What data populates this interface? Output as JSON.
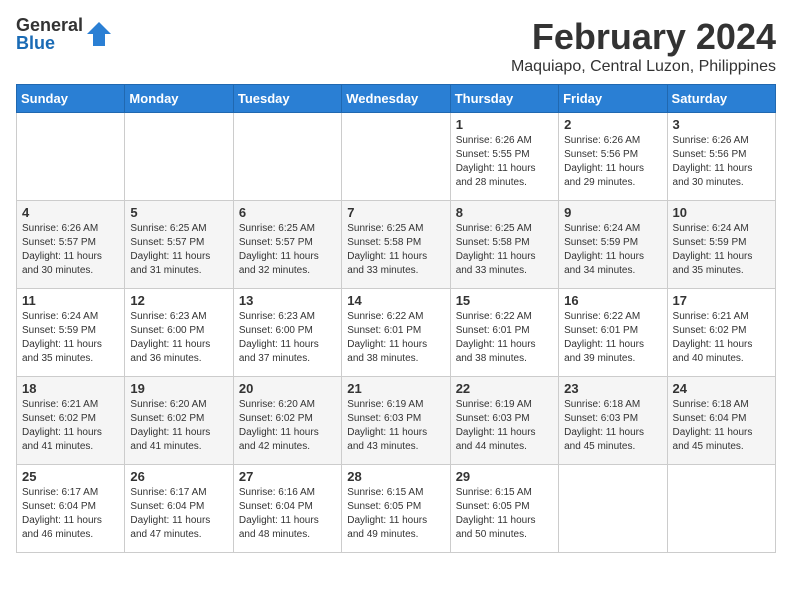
{
  "header": {
    "logo_general": "General",
    "logo_blue": "Blue",
    "month_title": "February 2024",
    "location": "Maquiapo, Central Luzon, Philippines"
  },
  "days_of_week": [
    "Sunday",
    "Monday",
    "Tuesday",
    "Wednesday",
    "Thursday",
    "Friday",
    "Saturday"
  ],
  "weeks": [
    {
      "days": [
        {
          "num": "",
          "info": ""
        },
        {
          "num": "",
          "info": ""
        },
        {
          "num": "",
          "info": ""
        },
        {
          "num": "",
          "info": ""
        },
        {
          "num": "1",
          "info": "Sunrise: 6:26 AM\nSunset: 5:55 PM\nDaylight: 11 hours and 28 minutes."
        },
        {
          "num": "2",
          "info": "Sunrise: 6:26 AM\nSunset: 5:56 PM\nDaylight: 11 hours and 29 minutes."
        },
        {
          "num": "3",
          "info": "Sunrise: 6:26 AM\nSunset: 5:56 PM\nDaylight: 11 hours and 30 minutes."
        }
      ]
    },
    {
      "days": [
        {
          "num": "4",
          "info": "Sunrise: 6:26 AM\nSunset: 5:57 PM\nDaylight: 11 hours and 30 minutes."
        },
        {
          "num": "5",
          "info": "Sunrise: 6:25 AM\nSunset: 5:57 PM\nDaylight: 11 hours and 31 minutes."
        },
        {
          "num": "6",
          "info": "Sunrise: 6:25 AM\nSunset: 5:57 PM\nDaylight: 11 hours and 32 minutes."
        },
        {
          "num": "7",
          "info": "Sunrise: 6:25 AM\nSunset: 5:58 PM\nDaylight: 11 hours and 33 minutes."
        },
        {
          "num": "8",
          "info": "Sunrise: 6:25 AM\nSunset: 5:58 PM\nDaylight: 11 hours and 33 minutes."
        },
        {
          "num": "9",
          "info": "Sunrise: 6:24 AM\nSunset: 5:59 PM\nDaylight: 11 hours and 34 minutes."
        },
        {
          "num": "10",
          "info": "Sunrise: 6:24 AM\nSunset: 5:59 PM\nDaylight: 11 hours and 35 minutes."
        }
      ]
    },
    {
      "days": [
        {
          "num": "11",
          "info": "Sunrise: 6:24 AM\nSunset: 5:59 PM\nDaylight: 11 hours and 35 minutes."
        },
        {
          "num": "12",
          "info": "Sunrise: 6:23 AM\nSunset: 6:00 PM\nDaylight: 11 hours and 36 minutes."
        },
        {
          "num": "13",
          "info": "Sunrise: 6:23 AM\nSunset: 6:00 PM\nDaylight: 11 hours and 37 minutes."
        },
        {
          "num": "14",
          "info": "Sunrise: 6:22 AM\nSunset: 6:01 PM\nDaylight: 11 hours and 38 minutes."
        },
        {
          "num": "15",
          "info": "Sunrise: 6:22 AM\nSunset: 6:01 PM\nDaylight: 11 hours and 38 minutes."
        },
        {
          "num": "16",
          "info": "Sunrise: 6:22 AM\nSunset: 6:01 PM\nDaylight: 11 hours and 39 minutes."
        },
        {
          "num": "17",
          "info": "Sunrise: 6:21 AM\nSunset: 6:02 PM\nDaylight: 11 hours and 40 minutes."
        }
      ]
    },
    {
      "days": [
        {
          "num": "18",
          "info": "Sunrise: 6:21 AM\nSunset: 6:02 PM\nDaylight: 11 hours and 41 minutes."
        },
        {
          "num": "19",
          "info": "Sunrise: 6:20 AM\nSunset: 6:02 PM\nDaylight: 11 hours and 41 minutes."
        },
        {
          "num": "20",
          "info": "Sunrise: 6:20 AM\nSunset: 6:02 PM\nDaylight: 11 hours and 42 minutes."
        },
        {
          "num": "21",
          "info": "Sunrise: 6:19 AM\nSunset: 6:03 PM\nDaylight: 11 hours and 43 minutes."
        },
        {
          "num": "22",
          "info": "Sunrise: 6:19 AM\nSunset: 6:03 PM\nDaylight: 11 hours and 44 minutes."
        },
        {
          "num": "23",
          "info": "Sunrise: 6:18 AM\nSunset: 6:03 PM\nDaylight: 11 hours and 45 minutes."
        },
        {
          "num": "24",
          "info": "Sunrise: 6:18 AM\nSunset: 6:04 PM\nDaylight: 11 hours and 45 minutes."
        }
      ]
    },
    {
      "days": [
        {
          "num": "25",
          "info": "Sunrise: 6:17 AM\nSunset: 6:04 PM\nDaylight: 11 hours and 46 minutes."
        },
        {
          "num": "26",
          "info": "Sunrise: 6:17 AM\nSunset: 6:04 PM\nDaylight: 11 hours and 47 minutes."
        },
        {
          "num": "27",
          "info": "Sunrise: 6:16 AM\nSunset: 6:04 PM\nDaylight: 11 hours and 48 minutes."
        },
        {
          "num": "28",
          "info": "Sunrise: 6:15 AM\nSunset: 6:05 PM\nDaylight: 11 hours and 49 minutes."
        },
        {
          "num": "29",
          "info": "Sunrise: 6:15 AM\nSunset: 6:05 PM\nDaylight: 11 hours and 50 minutes."
        },
        {
          "num": "",
          "info": ""
        },
        {
          "num": "",
          "info": ""
        }
      ]
    }
  ]
}
